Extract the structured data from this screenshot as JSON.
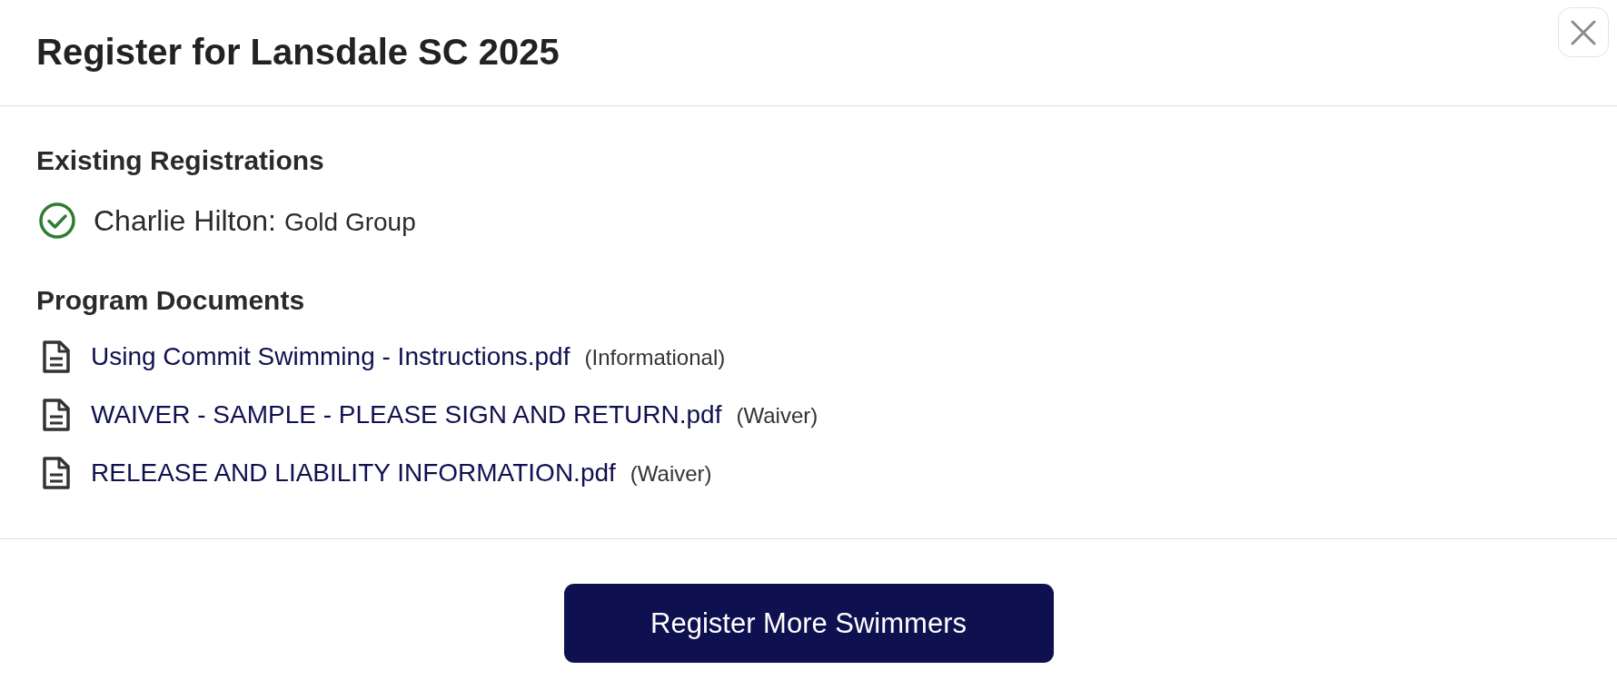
{
  "dialog": {
    "title": "Register for Lansdale SC 2025"
  },
  "existing_registrations": {
    "heading": "Existing Registrations",
    "items": [
      {
        "name": "Charlie Hilton:",
        "group": "Gold Group"
      }
    ]
  },
  "program_documents": {
    "heading": "Program Documents",
    "items": [
      {
        "file": "Using Commit Swimming - Instructions.pdf",
        "type": "(Informational)"
      },
      {
        "file": "WAIVER - SAMPLE - PLEASE SIGN AND RETURN.pdf",
        "type": "(Waiver)"
      },
      {
        "file": "RELEASE AND LIABILITY INFORMATION.pdf",
        "type": "(Waiver)"
      }
    ]
  },
  "footer": {
    "button": "Register More Swimmers"
  }
}
